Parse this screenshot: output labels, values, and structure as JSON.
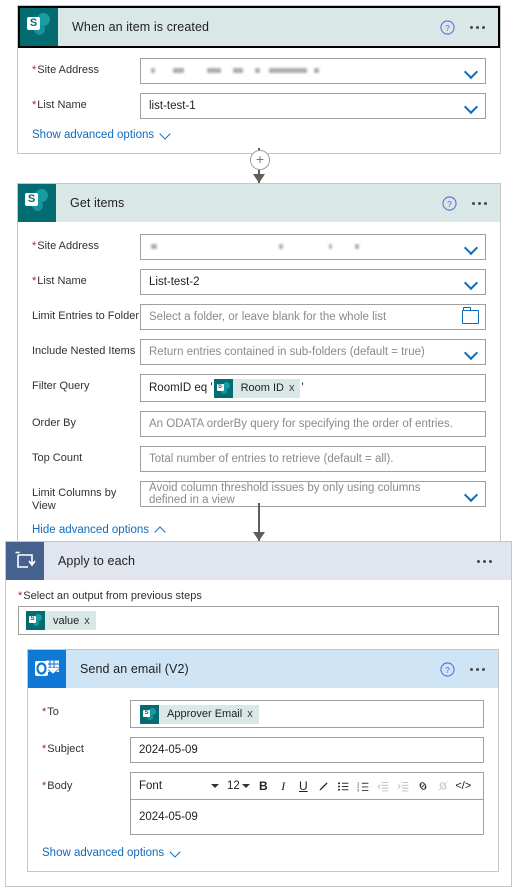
{
  "trigger_card": {
    "icon": "sharepoint-icon",
    "title": "When an item is created",
    "help_icon": "help-icon",
    "menu_icon": "ellipsis-icon",
    "fields": [
      {
        "label": "Site Address",
        "required": true,
        "value": "",
        "redacted": true,
        "control": "dropdown"
      },
      {
        "label": "List Name",
        "required": true,
        "value": "list-test-1",
        "control": "dropdown"
      }
    ],
    "advanced_link": {
      "label": "Show advanced options",
      "chevron": "chevron-down-icon",
      "expanded": false
    }
  },
  "connector_1": {
    "plus_label": "+",
    "arrow": "arrow-down-icon"
  },
  "get_items_card": {
    "icon": "sharepoint-icon",
    "title": "Get items",
    "help_icon": "help-icon",
    "menu_icon": "ellipsis-icon",
    "fields": [
      {
        "label": "Site Address",
        "required": true,
        "value": "",
        "redacted": true,
        "control": "dropdown"
      },
      {
        "label": "List Name",
        "required": true,
        "value": "List-test-2",
        "control": "dropdown"
      },
      {
        "label": "Limit Entries to Folder",
        "required": false,
        "placeholder": "Select a folder, or leave blank for the whole list",
        "control": "folder"
      },
      {
        "label": "Include Nested Items",
        "required": false,
        "placeholder": "Return entries contained in sub-folders (default = true)",
        "control": "dropdown"
      },
      {
        "label": "Filter Query",
        "required": false,
        "control": "token"
      },
      {
        "label": "Order By",
        "required": false,
        "placeholder": "An ODATA orderBy query for specifying the order of entries.",
        "control": "text"
      },
      {
        "label": "Top Count",
        "required": false,
        "placeholder": "Total number of entries to retrieve (default = all).",
        "control": "text"
      },
      {
        "label": "Limit Columns by View",
        "required": false,
        "placeholder": "Avoid column threshold issues by only using columns defined in a view",
        "control": "dropdown"
      }
    ],
    "filter_query": {
      "prefix": "RoomID eq '",
      "token_label": "Room ID",
      "token_icon": "sharepoint-icon",
      "token_remove": "x",
      "suffix": "'"
    },
    "advanced_link": {
      "label": "Hide advanced options",
      "chevron": "chevron-up-icon",
      "expanded": true
    }
  },
  "connector_2": {
    "arrow": "arrow-down-icon"
  },
  "apply_to_each_card": {
    "icon": "loop-icon",
    "title": "Apply to each",
    "menu_icon": "ellipsis-icon",
    "output_field": {
      "label": "Select an output from previous steps",
      "required": true,
      "token_label": "value",
      "token_icon": "sharepoint-icon",
      "token_remove": "x"
    },
    "email_card": {
      "icon": "outlook-icon",
      "title": "Send an email (V2)",
      "help_icon": "help-icon",
      "menu_icon": "ellipsis-icon",
      "to": {
        "label": "To",
        "required": true,
        "token_label": "Approver Email",
        "token_icon": "sharepoint-icon",
        "token_remove": "x"
      },
      "subject": {
        "label": "Subject",
        "required": true,
        "value": "2024-05-09"
      },
      "body": {
        "label": "Body",
        "value": "2024-05-09",
        "required": true,
        "toolbar": {
          "font_label": "Font",
          "font_caret": "chevron-down-icon",
          "size_label": "12",
          "size_caret": "chevron-down-icon",
          "bold": "B",
          "italic": "I",
          "underline": "U",
          "text_color": "pen-icon",
          "bulleted_list": "bulleted-list-icon",
          "numbered_list": "numbered-list-icon",
          "decrease_indent": "decrease-indent-icon",
          "increase_indent": "increase-indent-icon",
          "link": "link-icon",
          "unlink": "unlink-icon",
          "code_view": "</>"
        }
      },
      "advanced_link": {
        "label": "Show advanced options",
        "chevron": "chevron-down-icon",
        "expanded": false
      }
    }
  },
  "colors": {
    "sharepoint_teal": "#036c70",
    "outlook_blue": "#0f78d4",
    "loop_blue": "#47618f",
    "header_sp": "#d9e8e6",
    "header_email": "#cfe4f5",
    "header_loop": "#e1e5ee",
    "link_blue": "#0f6cbd",
    "required_red": "#a4262c"
  }
}
